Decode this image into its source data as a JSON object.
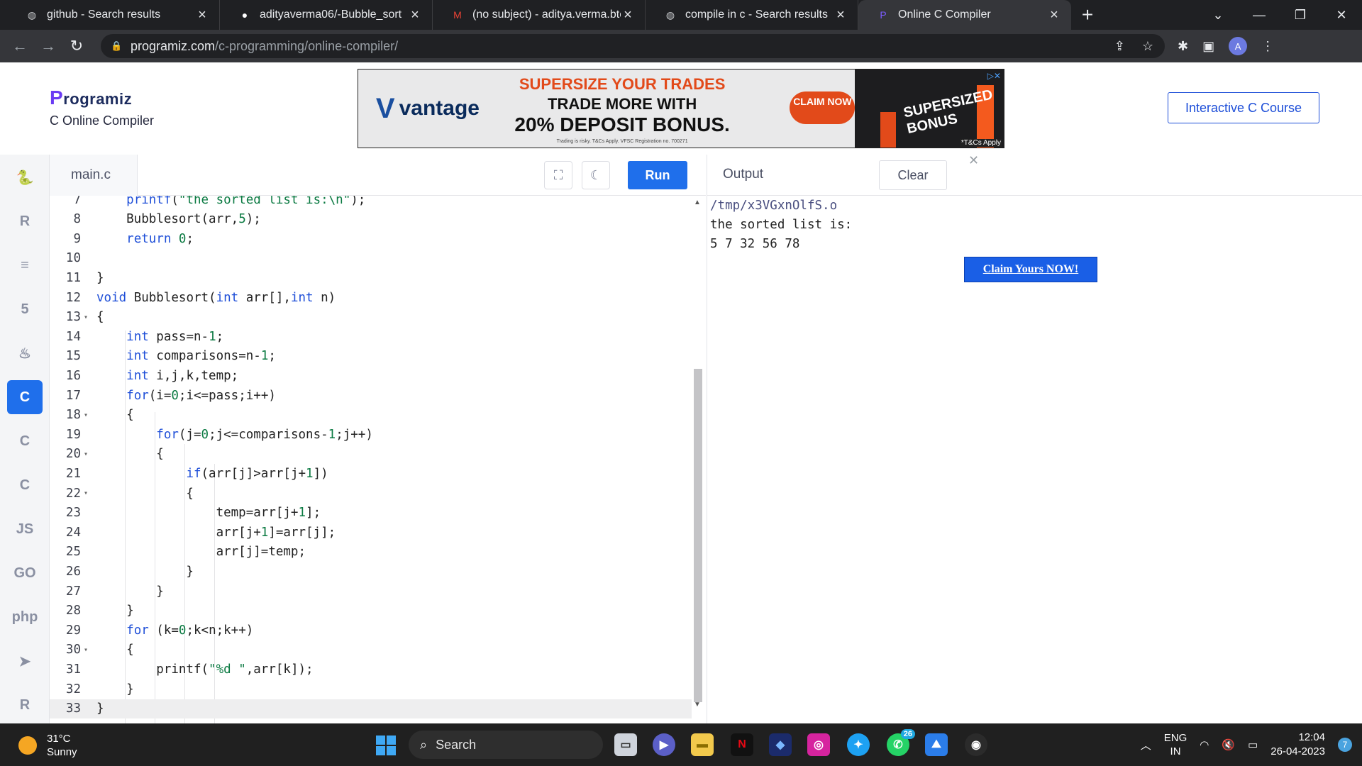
{
  "browser": {
    "tabs": [
      {
        "title": "github - Search results",
        "icon": "globe-icon",
        "active": false
      },
      {
        "title": "adityaverma06/-Bubble_sort",
        "icon": "github-icon",
        "active": false
      },
      {
        "title": "(no subject) - aditya.verma.btech",
        "icon": "gmail-icon",
        "active": false
      },
      {
        "title": "compile in c - Search results",
        "icon": "globe-icon",
        "active": false
      },
      {
        "title": "Online C Compiler",
        "icon": "programiz-icon",
        "active": true
      }
    ],
    "new_tab": "+",
    "url_host": "programiz.com",
    "url_path": "/c-programming/online-compiler/",
    "profile_initial": "A"
  },
  "header": {
    "logo_text": "rogramiz",
    "logo_p": "P",
    "subtitle": "C Online Compiler",
    "course_button": "Interactive C Course"
  },
  "ad": {
    "brand": "vantage",
    "line1": "SUPERSIZE YOUR TRADES",
    "line2": "TRADE MORE WITH",
    "line3": "20% DEPOSIT BONUS.",
    "fine_print": "Trading is risky. T&Cs Apply. VFSC Registration no. 700271",
    "claim": "CLAIM NOW",
    "art_text": "SUPERSIZED BONUS",
    "tc": "*T&Cs Apply"
  },
  "editor": {
    "filename": "main.c",
    "run_label": "Run",
    "lines": [
      {
        "n": "7",
        "fold": false,
        "html": "    <span class='kw'>printf</span>(<span class='str'>\"the sorted list is:\\n\"</span>);"
      },
      {
        "n": "8",
        "fold": false,
        "html": "    Bubblesort(arr,<span class='num'>5</span>);"
      },
      {
        "n": "9",
        "fold": false,
        "html": "    <span class='kw'>return</span> <span class='num'>0</span>;"
      },
      {
        "n": "10",
        "fold": false,
        "html": ""
      },
      {
        "n": "11",
        "fold": false,
        "html": "}"
      },
      {
        "n": "12",
        "fold": false,
        "html": "<span class='kw'>void</span> Bubblesort(<span class='kw'>int</span> arr[],<span class='kw'>int</span> n)"
      },
      {
        "n": "13",
        "fold": true,
        "html": "{"
      },
      {
        "n": "14",
        "fold": false,
        "html": "    <span class='kw'>int</span> pass=n-<span class='num'>1</span>;"
      },
      {
        "n": "15",
        "fold": false,
        "html": "    <span class='kw'>int</span> comparisons=n-<span class='num'>1</span>;"
      },
      {
        "n": "16",
        "fold": false,
        "html": "    <span class='kw'>int</span> i,j,k,temp;"
      },
      {
        "n": "17",
        "fold": false,
        "html": "    <span class='kw'>for</span>(i=<span class='num'>0</span>;i&lt;=pass;i++)"
      },
      {
        "n": "18",
        "fold": true,
        "html": "    {"
      },
      {
        "n": "19",
        "fold": false,
        "html": "        <span class='kw'>for</span>(j=<span class='num'>0</span>;j&lt;=comparisons-<span class='num'>1</span>;j++)"
      },
      {
        "n": "20",
        "fold": true,
        "html": "        {"
      },
      {
        "n": "21",
        "fold": false,
        "html": "            <span class='kw'>if</span>(arr[j]&gt;arr[j+<span class='num'>1</span>])"
      },
      {
        "n": "22",
        "fold": true,
        "html": "            {"
      },
      {
        "n": "23",
        "fold": false,
        "html": "                temp=arr[j+<span class='num'>1</span>];"
      },
      {
        "n": "24",
        "fold": false,
        "html": "                arr[j+<span class='num'>1</span>]=arr[j];"
      },
      {
        "n": "25",
        "fold": false,
        "html": "                arr[j]=temp;"
      },
      {
        "n": "26",
        "fold": false,
        "html": "            }"
      },
      {
        "n": "27",
        "fold": false,
        "html": "        }"
      },
      {
        "n": "28",
        "fold": false,
        "html": "    }"
      },
      {
        "n": "29",
        "fold": false,
        "html": "    <span class='kw'>for</span> (k=<span class='num'>0</span>;k&lt;n;k++)"
      },
      {
        "n": "30",
        "fold": true,
        "html": "    {"
      },
      {
        "n": "31",
        "fold": false,
        "html": "        printf(<span class='str'>\"%d \"</span>,arr[k]);"
      },
      {
        "n": "32",
        "fold": false,
        "html": "    }"
      },
      {
        "n": "33",
        "fold": false,
        "html": "}",
        "current": true
      }
    ]
  },
  "output": {
    "title": "Output",
    "clear_label": "Clear",
    "lines": [
      "/tmp/x3VGxnOlfS.o",
      "the sorted list is:",
      "5 7 32 56 78"
    ],
    "claim_button": "Claim Yours NOW!"
  },
  "languages": [
    {
      "name": "python-icon",
      "glyph": "🐍"
    },
    {
      "name": "r-icon",
      "glyph": "R"
    },
    {
      "name": "sql-icon",
      "glyph": "≡"
    },
    {
      "name": "html5-icon",
      "glyph": "5"
    },
    {
      "name": "java-icon",
      "glyph": "♨"
    },
    {
      "name": "c-icon",
      "glyph": "C",
      "active": true
    },
    {
      "name": "cpp-icon",
      "glyph": "C"
    },
    {
      "name": "csharp-icon",
      "glyph": "C"
    },
    {
      "name": "js-icon",
      "glyph": "JS"
    },
    {
      "name": "go-icon",
      "glyph": "GO"
    },
    {
      "name": "php-icon",
      "glyph": "php"
    },
    {
      "name": "swift-icon",
      "glyph": "➤"
    },
    {
      "name": "rust-icon",
      "glyph": "R"
    }
  ],
  "taskbar": {
    "temperature": "31°C",
    "weather": "Sunny",
    "search": "Search",
    "whatsapp_badge": "26",
    "lang_line1": "ENG",
    "lang_line2": "IN",
    "time": "12:04",
    "date": "26-04-2023",
    "notifications": "7"
  },
  "colors": {
    "accent": "#1f6feb",
    "keyword": "#1f4fd8",
    "number": "#0b7a42",
    "ad_orange": "#e24a1a"
  }
}
